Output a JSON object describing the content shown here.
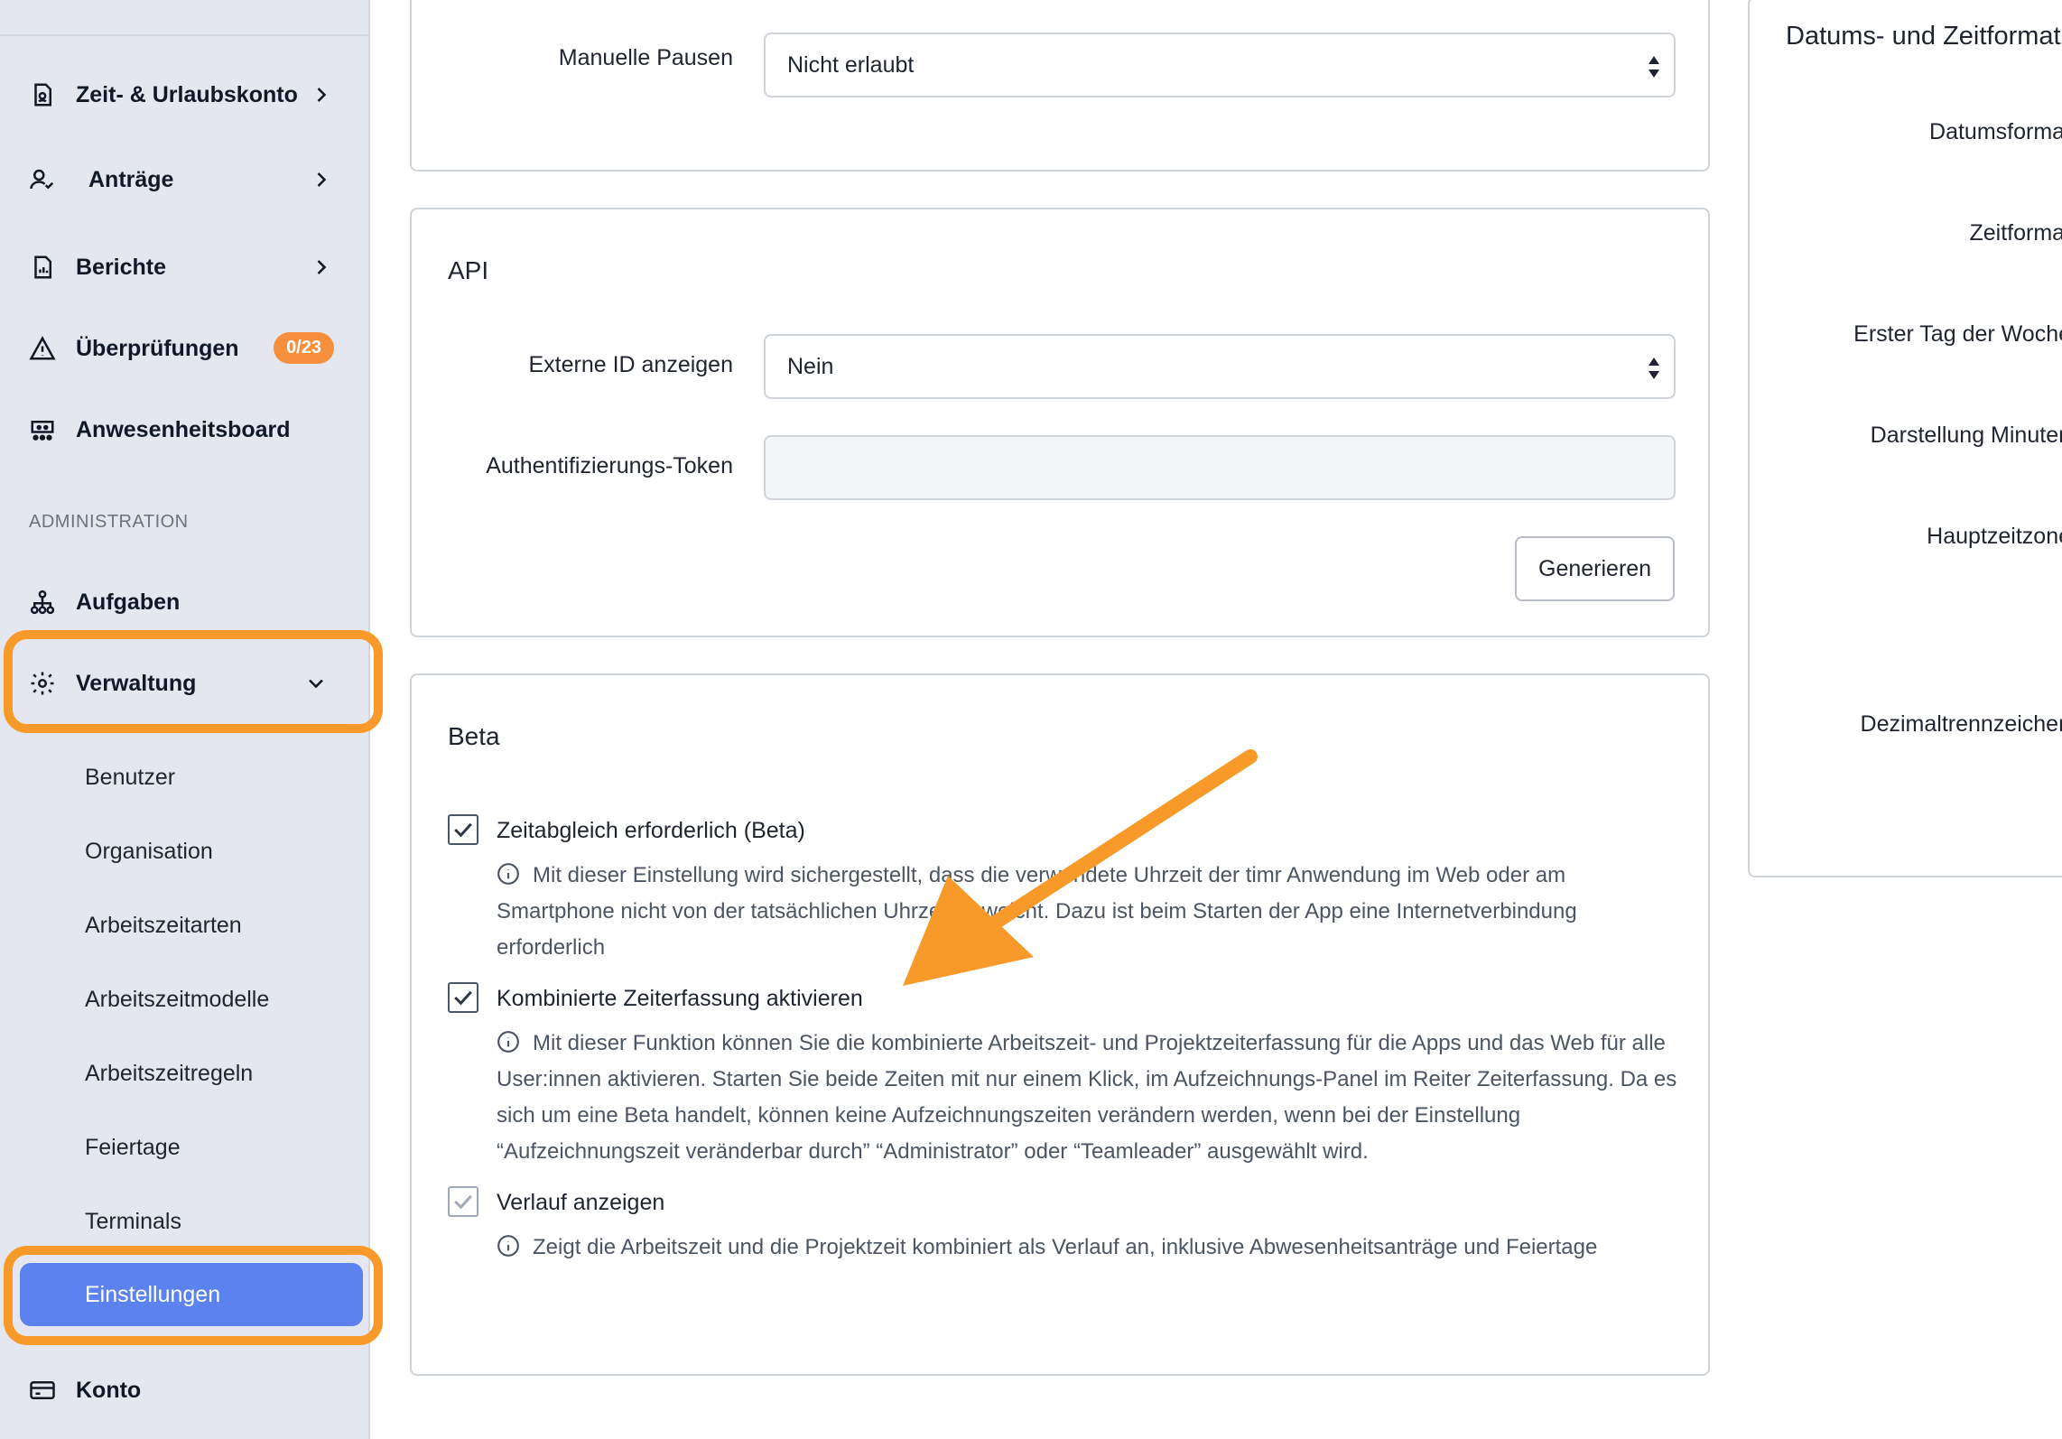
{
  "sidebar": {
    "nav": [
      {
        "label": "Zeit- & Urlaubskonto",
        "icon": "time-account-icon",
        "has_chevron": true
      },
      {
        "label": "Anträge",
        "icon": "user-check-icon",
        "has_chevron": true
      },
      {
        "label": "Berichte",
        "icon": "report-icon",
        "has_chevron": true
      },
      {
        "label": "Überprüfungen",
        "icon": "warning-icon",
        "badge": "0/23"
      },
      {
        "label": "Anwesenheitsboard",
        "icon": "presence-board-icon"
      }
    ],
    "section_label": "ADMINISTRATION",
    "admin": [
      {
        "label": "Aufgaben",
        "icon": "hierarchy-icon"
      },
      {
        "label": "Verwaltung",
        "icon": "gear-icon",
        "expanded": true
      }
    ],
    "sub_items": [
      "Benutzer",
      "Organisation",
      "Arbeitszeitarten",
      "Arbeitszeitmodelle",
      "Arbeitszeitregeln",
      "Feiertage",
      "Terminals"
    ],
    "active_sub": "Einstellungen",
    "bottom": {
      "label": "Konto",
      "icon": "card-icon"
    },
    "highlight_color": "#f89a2a",
    "active_color": "#5c82f0"
  },
  "panels": {
    "pauses": {
      "label": "Manuelle Pausen",
      "value": "Nicht erlaubt"
    },
    "api": {
      "title": "API",
      "external_id_label": "Externe ID anzeigen",
      "external_id_value": "Nein",
      "token_label": "Authentifizierungs-Token",
      "token_value": "",
      "generate_button": "Generieren"
    },
    "beta": {
      "title": "Beta",
      "options": [
        {
          "label": "Zeitabgleich erforderlich (Beta)",
          "checked": true,
          "description": "Mit dieser Einstellung wird sichergestellt, dass die verwendete Uhrzeit der timr Anwendung im Web oder am Smartphone nicht von der tatsächlichen Uhrzeit abweicht. Dazu ist beim Starten der App eine Internetverbindung erforderlich"
        },
        {
          "label": "Kombinierte Zeiterfassung aktivieren",
          "checked": true,
          "description": "Mit dieser Funktion können Sie die kombinierte Arbeitszeit- und Projektzeiterfassung für die Apps und das Web für alle User:innen aktivieren. Starten Sie beide Zeiten mit nur einem Klick, im Aufzeichnungs-Panel im Reiter Zeiterfassung. Da es sich um eine Beta handelt, können keine Aufzeichnungszeiten verändern werden, wenn bei der Einstellung “Aufzeichnungszeit veränderbar durch” “Administrator” oder “Teamleader” ausgewählt wird."
        },
        {
          "label": "Verlauf anzeigen",
          "checked": true,
          "disabled": true,
          "description": "Zeigt die Arbeitszeit und die Projektzeit kombiniert als Verlauf an, inklusive Abwesenheitsanträge und Feiertage"
        }
      ]
    }
  },
  "right_panel": {
    "title": "Datums- und Zeitformat",
    "labels": [
      "Datumsformat",
      "Zeitformat",
      "Erster Tag der Woche",
      "Darstellung Minuten",
      "Hauptzeitzone",
      "Dezimaltrennzeichen"
    ]
  },
  "annotation": {
    "arrow_color": "#f89a2a"
  }
}
